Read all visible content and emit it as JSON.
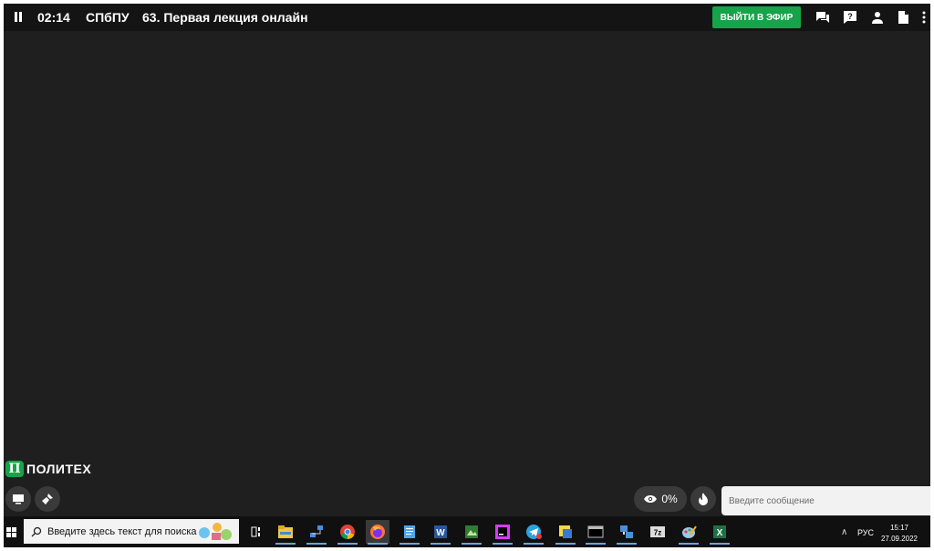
{
  "topbar": {
    "time": "02:14",
    "org": "СПбПУ",
    "title": "63. Первая лекция онлайн",
    "live_button": "ВЫЙТИ В ЭФИР"
  },
  "logo": {
    "mark": "П",
    "text": "ПОЛИТЕХ"
  },
  "viewers": {
    "percent": "0%"
  },
  "chat": {
    "placeholder": "Введите сообщение"
  },
  "taskbar": {
    "search_placeholder": "Введите здесь текст для поиска",
    "language": "РУС",
    "time": "15:17",
    "date": "27.09.2022",
    "apps": [
      "task-view",
      "file-explorer",
      "network",
      "chrome",
      "firefox",
      "notepad",
      "word",
      "app-green",
      "jetbrains",
      "telegram",
      "sticky-app",
      "terminal",
      "network-app",
      "7zip",
      "paint",
      "excel"
    ]
  },
  "colors": {
    "accent": "#16a34a",
    "stage_bg": "#1f1f1f",
    "topbar_bg": "#141414",
    "taskbar_bg": "#101010"
  }
}
